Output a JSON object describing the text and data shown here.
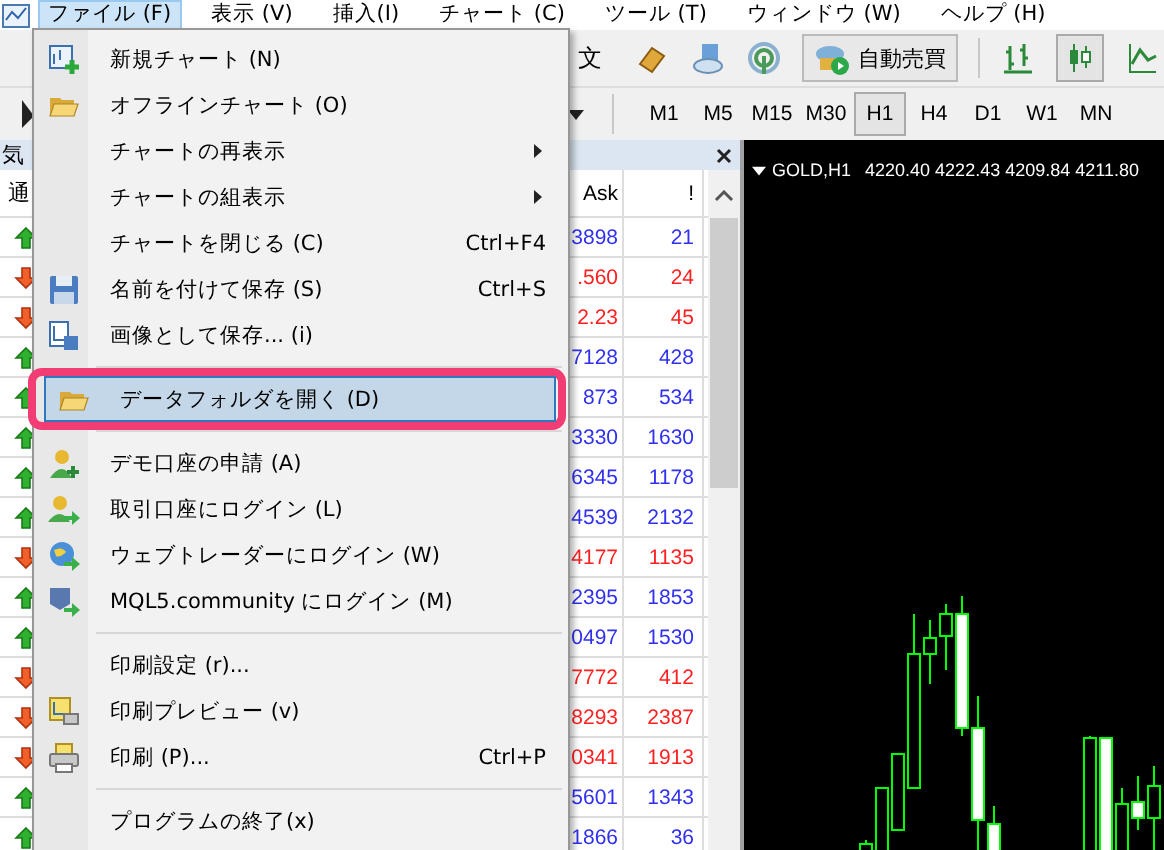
{
  "menu_bar": [
    {
      "label": "ファイル (F)",
      "selected": true
    },
    {
      "label": "表示 (V)",
      "selected": false
    },
    {
      "label": "挿入(I)",
      "selected": false
    },
    {
      "label": "チャート (C)",
      "selected": false
    },
    {
      "label": "ツール (T)",
      "selected": false
    },
    {
      "label": "ウィンドウ (W)",
      "selected": false
    },
    {
      "label": "ヘルプ (H)",
      "selected": false
    }
  ],
  "toolbar": {
    "order_text": "文",
    "auto_trading": "自動売買",
    "timeframes": [
      {
        "label": "M1",
        "selected": false
      },
      {
        "label": "M5",
        "selected": false
      },
      {
        "label": "M15",
        "selected": false
      },
      {
        "label": "M30",
        "selected": false
      },
      {
        "label": "H1",
        "selected": true
      },
      {
        "label": "H4",
        "selected": false
      },
      {
        "label": "D1",
        "selected": false
      },
      {
        "label": "W1",
        "selected": false
      },
      {
        "label": "MN",
        "selected": false
      }
    ]
  },
  "market_watch": {
    "title": "気",
    "columns": [
      "通",
      "Ask",
      "!"
    ],
    "rows": [
      {
        "up": true,
        "ask": "3898",
        "spread": "21"
      },
      {
        "up": false,
        "ask": ".560",
        "spread": "24"
      },
      {
        "up": false,
        "ask": "2.23",
        "spread": "45"
      },
      {
        "up": true,
        "ask": "7128",
        "spread": "428"
      },
      {
        "up": true,
        "ask": "873",
        "spread": "534"
      },
      {
        "up": true,
        "ask": "3330",
        "spread": "1630"
      },
      {
        "up": true,
        "ask": "6345",
        "spread": "1178"
      },
      {
        "up": true,
        "ask": "4539",
        "spread": "2132"
      },
      {
        "up": false,
        "ask": "4177",
        "spread": "1135"
      },
      {
        "up": true,
        "ask": "2395",
        "spread": "1853"
      },
      {
        "up": true,
        "ask": "0497",
        "spread": "1530"
      },
      {
        "up": false,
        "ask": "7772",
        "spread": "412"
      },
      {
        "up": false,
        "ask": "8293",
        "spread": "2387"
      },
      {
        "up": false,
        "ask": "0341",
        "spread": "1913"
      },
      {
        "up": true,
        "ask": "5601",
        "spread": "1343"
      },
      {
        "up": true,
        "ask": "1866",
        "spread": "36"
      }
    ]
  },
  "chart": {
    "title": "GOLD,H1",
    "ohlc": "4220.40 4222.43 4209.84 4211.80"
  },
  "file_menu": {
    "items": [
      {
        "kind": "item",
        "label": "新規チャート (N)",
        "selected": false
      },
      {
        "kind": "item",
        "label": "オフラインチャート (O)",
        "selected": false
      },
      {
        "kind": "item",
        "label": "チャートの再表示",
        "submenu": true,
        "selected": false
      },
      {
        "kind": "item",
        "label": "チャートの組表示",
        "submenu": true,
        "selected": false
      },
      {
        "kind": "item",
        "label": "チャートを閉じる (C)",
        "shortcut": "Ctrl+F4",
        "selected": false
      },
      {
        "kind": "item",
        "label": "名前を付けて保存 (S)",
        "shortcut": "Ctrl+S",
        "selected": false
      },
      {
        "kind": "item",
        "label": "画像として保存... (i)",
        "selected": false
      },
      {
        "kind": "separator"
      },
      {
        "kind": "item",
        "label": "データフォルダを開く (D)",
        "selected": true
      },
      {
        "kind": "separator"
      },
      {
        "kind": "item",
        "label": "デモ口座の申請 (A)",
        "selected": false
      },
      {
        "kind": "item",
        "label": "取引口座にログイン (L)",
        "selected": false
      },
      {
        "kind": "item",
        "label": "ウェブトレーダーにログイン (W)",
        "selected": false
      },
      {
        "kind": "item",
        "label": "MQL5.community にログイン (M)",
        "selected": false
      },
      {
        "kind": "separator"
      },
      {
        "kind": "item",
        "label": "印刷設定 (r)...",
        "selected": false
      },
      {
        "kind": "item",
        "label": "印刷プレビュー (v)",
        "selected": false
      },
      {
        "kind": "item",
        "label": "印刷 (P)...",
        "shortcut": "Ctrl+P",
        "selected": false
      },
      {
        "kind": "separator"
      },
      {
        "kind": "item",
        "label": "プログラムの終了(x)",
        "selected": false
      }
    ]
  }
}
